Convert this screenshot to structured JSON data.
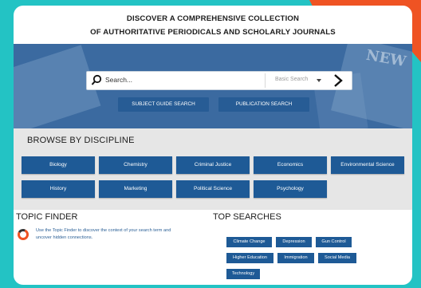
{
  "headline": {
    "line1": "DISCOVER A COMPREHENSIVE COLLECTION",
    "line2": "OF AUTHORITATIVE PERIODICALS AND SCHOLARLY JOURNALS"
  },
  "hero": {
    "masthead_text": "NEW",
    "search": {
      "placeholder": "Search...",
      "mode": "Basic Search"
    },
    "buttons": [
      "SUBJECT GUIDE SEARCH",
      "PUBLICATION SEARCH"
    ]
  },
  "browse": {
    "title": "BROWSE BY DISCIPLINE",
    "disciplines": [
      "Biology",
      "Chemistry",
      "Criminal Justice",
      "Economics",
      "Environmental Science",
      "History",
      "Marketing",
      "Political Science",
      "Psychology"
    ]
  },
  "topic_finder": {
    "title": "TOPIC FINDER",
    "text": "Use the Topic Finder to discover the context of your search term and uncover hidden connections."
  },
  "top_searches": {
    "title": "TOP SEARCHES",
    "tags": [
      "Climate Change",
      "Depression",
      "Gun Control",
      "Higher Education",
      "Immigration",
      "Social Media",
      "Technology"
    ]
  },
  "colors": {
    "background": "#23c3c4",
    "accent": "#ef5323",
    "hero": "#3b6aa0",
    "button": "#1e5a96",
    "link": "#2a5f96"
  }
}
